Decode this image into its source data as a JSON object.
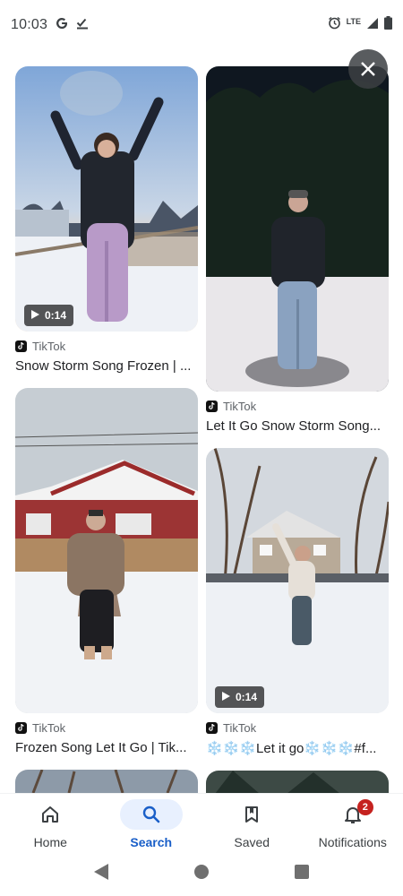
{
  "status_bar": {
    "time": "10:03",
    "network": "LTE"
  },
  "results": {
    "left": [
      {
        "source": "TikTok",
        "caption": "Snow Storm Song Frozen | ...",
        "duration": "0:14"
      },
      {
        "source": "TikTok",
        "caption": "Frozen Song Let It Go | Tik..."
      }
    ],
    "right": [
      {
        "source": "TikTok",
        "caption": "Let It Go Snow Storm Song..."
      },
      {
        "source": "TikTok",
        "caption": "❄️❄️❄️Let it go❄️❄️❄️#f...",
        "duration": "0:14"
      }
    ]
  },
  "bottom_nav": {
    "items": [
      {
        "label": "Home",
        "icon": "home-icon"
      },
      {
        "label": "Search",
        "icon": "search-icon",
        "active": true
      },
      {
        "label": "Saved",
        "icon": "bookmark-icon"
      },
      {
        "label": "Notifications",
        "icon": "bell-icon",
        "badge": "2"
      }
    ]
  },
  "colors": {
    "accent": "#1a5fc8",
    "active_pill": "#e8f0fe",
    "badge": "#c5221f"
  }
}
